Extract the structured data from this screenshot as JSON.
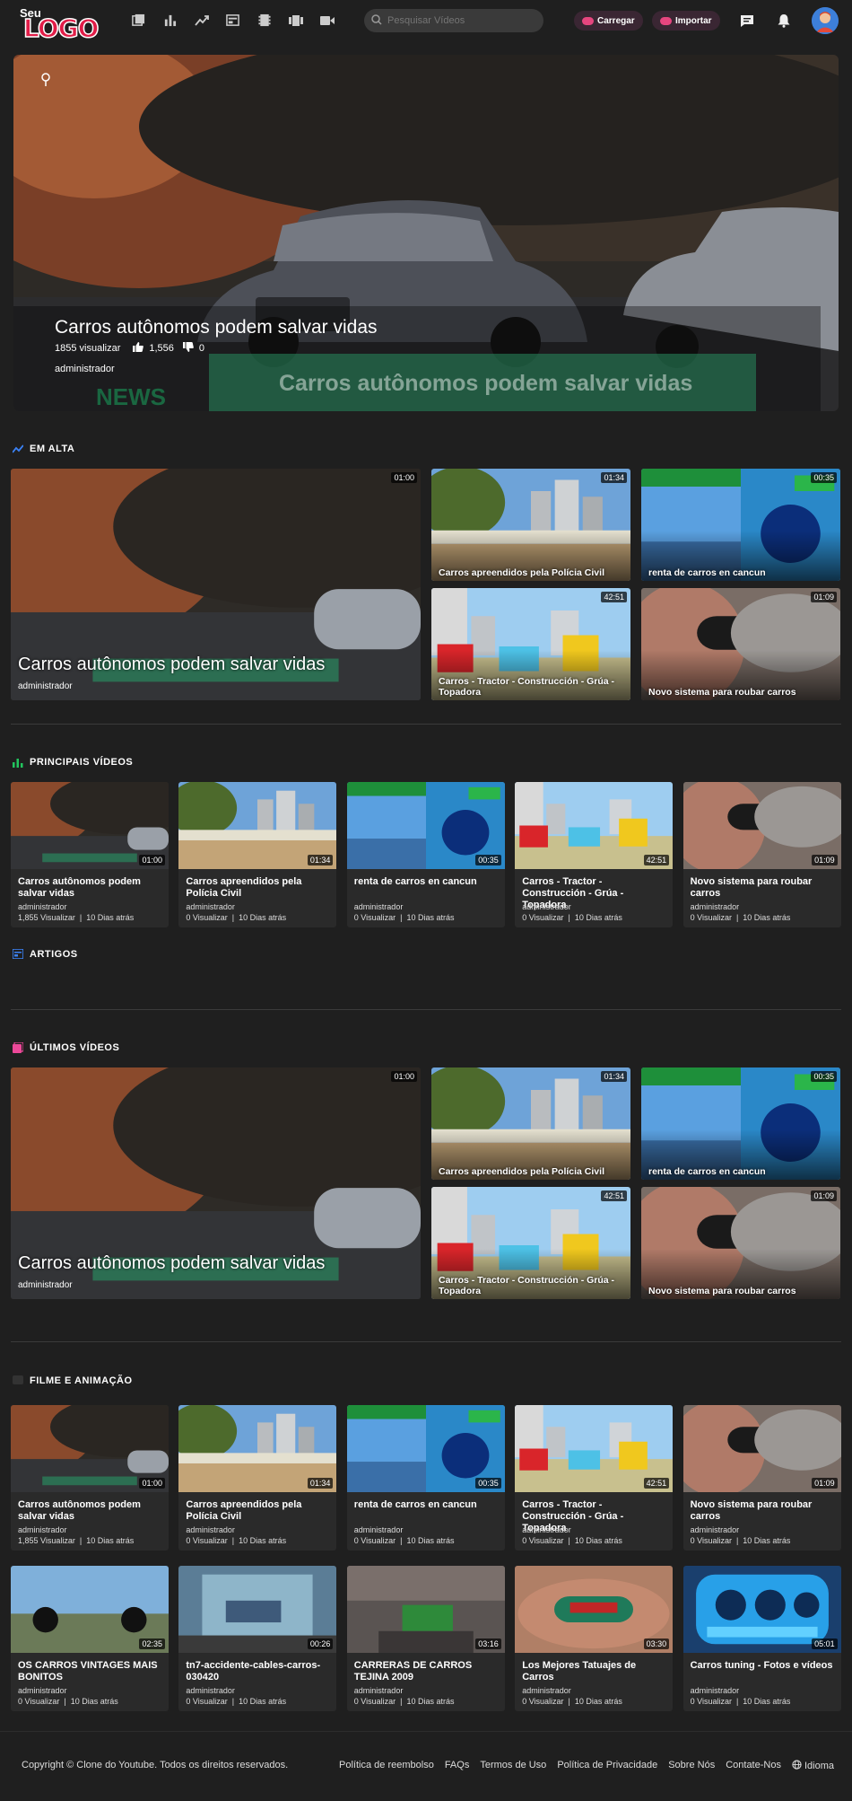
{
  "header": {
    "logo_top": "Seu",
    "logo_main": "LOGO",
    "search_placeholder": "Pesquisar Vídeos",
    "upload_label": "Carregar",
    "import_label": "Importar"
  },
  "hero": {
    "title": "Carros autônomos podem salvar vidas",
    "views": "1855 visualizar",
    "likes": "1,556",
    "dislikes": "0",
    "author": "administrador",
    "banner_text": "Carros autônomos podem salvar vidas",
    "news_text": "NEWS"
  },
  "sections": {
    "trending": "EM ALTA",
    "top": "PRINCIPAIS VÍDEOS",
    "articles": "ARTIGOS",
    "latest": "ÚLTIMOS VÍDEOS",
    "film": "FILME E ANIMAÇÃO"
  },
  "trending": {
    "main": {
      "title": "Carros autônomos podem salvar vidas",
      "author": "administrador",
      "duration": "01:00"
    },
    "items": [
      {
        "title": "Carros apreendidos pela Polícia Civil",
        "duration": "01:34"
      },
      {
        "title": "renta de carros en cancun",
        "duration": "00:35"
      },
      {
        "title": "Carros - Tractor - Construcción - Grúa - Topadora",
        "duration": "42:51"
      },
      {
        "title": "Novo sistema para roubar carros",
        "duration": "01:09"
      }
    ]
  },
  "latest": {
    "main": {
      "title": "Carros autônomos podem salvar vidas",
      "author": "administrador",
      "duration": "01:00"
    },
    "items": [
      {
        "title": "Carros apreendidos pela Polícia Civil",
        "duration": "01:34"
      },
      {
        "title": "renta de carros en cancun",
        "duration": "00:35"
      },
      {
        "title": "Carros - Tractor - Construcción - Grúa - Topadora",
        "duration": "42:51"
      },
      {
        "title": "Novo sistema para roubar carros",
        "duration": "01:09"
      }
    ]
  },
  "top_videos": [
    {
      "title": "Carros autônomos podem salvar vidas",
      "author": "administrador",
      "views": "1,855 Visualizar",
      "date": "10 Dias atrás",
      "duration": "01:00"
    },
    {
      "title": "Carros apreendidos pela Polícia Civil",
      "author": "administrador",
      "views": "0 Visualizar",
      "date": "10 Dias atrás",
      "duration": "01:34"
    },
    {
      "title": "renta de carros en cancun",
      "author": "administrador",
      "views": "0 Visualizar",
      "date": "10 Dias atrás",
      "duration": "00:35"
    },
    {
      "title": "Carros - Tractor - Construcción - Grúa - Topadora",
      "author": "administrador",
      "views": "0 Visualizar",
      "date": "10 Dias atrás",
      "duration": "42:51"
    },
    {
      "title": "Novo sistema para roubar carros",
      "author": "administrador",
      "views": "0 Visualizar",
      "date": "10 Dias atrás",
      "duration": "01:09"
    }
  ],
  "film_videos": [
    {
      "title": "Carros autônomos podem salvar vidas",
      "author": "administrador",
      "views": "1,855 Visualizar",
      "date": "10 Dias atrás",
      "duration": "01:00"
    },
    {
      "title": "Carros apreendidos pela Polícia Civil",
      "author": "administrador",
      "views": "0 Visualizar",
      "date": "10 Dias atrás",
      "duration": "01:34"
    },
    {
      "title": "renta de carros en cancun",
      "author": "administrador",
      "views": "0 Visualizar",
      "date": "10 Dias atrás",
      "duration": "00:35"
    },
    {
      "title": "Carros - Tractor - Construcción - Grúa - Topadora",
      "author": "administrador",
      "views": "0 Visualizar",
      "date": "10 Dias atrás",
      "duration": "42:51"
    },
    {
      "title": "Novo sistema para roubar carros",
      "author": "administrador",
      "views": "0 Visualizar",
      "date": "10 Dias atrás",
      "duration": "01:09"
    },
    {
      "title": "OS CARROS VINTAGES MAIS BONITOS",
      "author": "administrador",
      "views": "0 Visualizar",
      "date": "10 Dias atrás",
      "duration": "02:35"
    },
    {
      "title": "tn7-accidente-cables-carros-030420",
      "author": "administrador",
      "views": "0 Visualizar",
      "date": "10 Dias atrás",
      "duration": "00:26"
    },
    {
      "title": "CARRERAS DE CARROS TEJINA 2009",
      "author": "administrador",
      "views": "0 Visualizar",
      "date": "10 Dias atrás",
      "duration": "03:16"
    },
    {
      "title": "Los Mejores Tatuajes de Carros",
      "author": "administrador",
      "views": "0 Visualizar",
      "date": "10 Dias atrás",
      "duration": "03:30"
    },
    {
      "title": "Carros tuning - Fotos e vídeos",
      "author": "administrador",
      "views": "0 Visualizar",
      "date": "10 Dias atrás",
      "duration": "05:01"
    }
  ],
  "footer": {
    "copyright": "Copyright © Clone do Youtube. Todos os direitos reservados.",
    "links": [
      "Política de reembolso",
      "FAQs",
      "Termos de Uso",
      "Política de Privacidade",
      "Sobre Nós",
      "Contate-Nos",
      "Idioma"
    ]
  },
  "colors": {
    "accent": "#e11d48",
    "background": "#1f1f1f",
    "card": "#2a2a2a",
    "trending_icon": "#3b82f6",
    "top_icon": "#22c55e",
    "latest_icon": "#ec4899"
  }
}
